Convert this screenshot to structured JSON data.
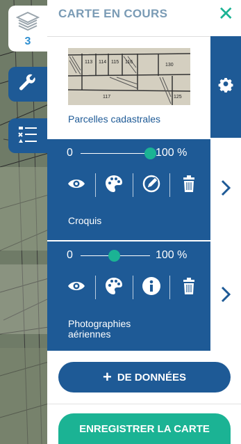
{
  "panel": {
    "title": "CARTE EN COURS",
    "close_symbol": "✕"
  },
  "tools": {
    "layers_count": "3"
  },
  "thumbnail": {
    "plot_numbers": [
      "113",
      "114",
      "115",
      "116",
      "130",
      "117",
      "125"
    ]
  },
  "layers": [
    {
      "name": "Parcelles cadastrales"
    },
    {
      "name": "Croquis",
      "opacity_min": "0",
      "opacity_max": "100 %",
      "opacity_value": 1.0
    },
    {
      "name": "Photographies aériennes",
      "opacity_min": "0",
      "opacity_max": "100 %",
      "opacity_value": 0.5
    }
  ],
  "buttons": {
    "add_data": "DE DONNÉES",
    "add_data_prefix": "+",
    "save_map": "ENREGISTRER LA CARTE"
  },
  "colors": {
    "primary": "#1e5a96",
    "accent": "#1bb394",
    "title": "#7a9bb5"
  }
}
